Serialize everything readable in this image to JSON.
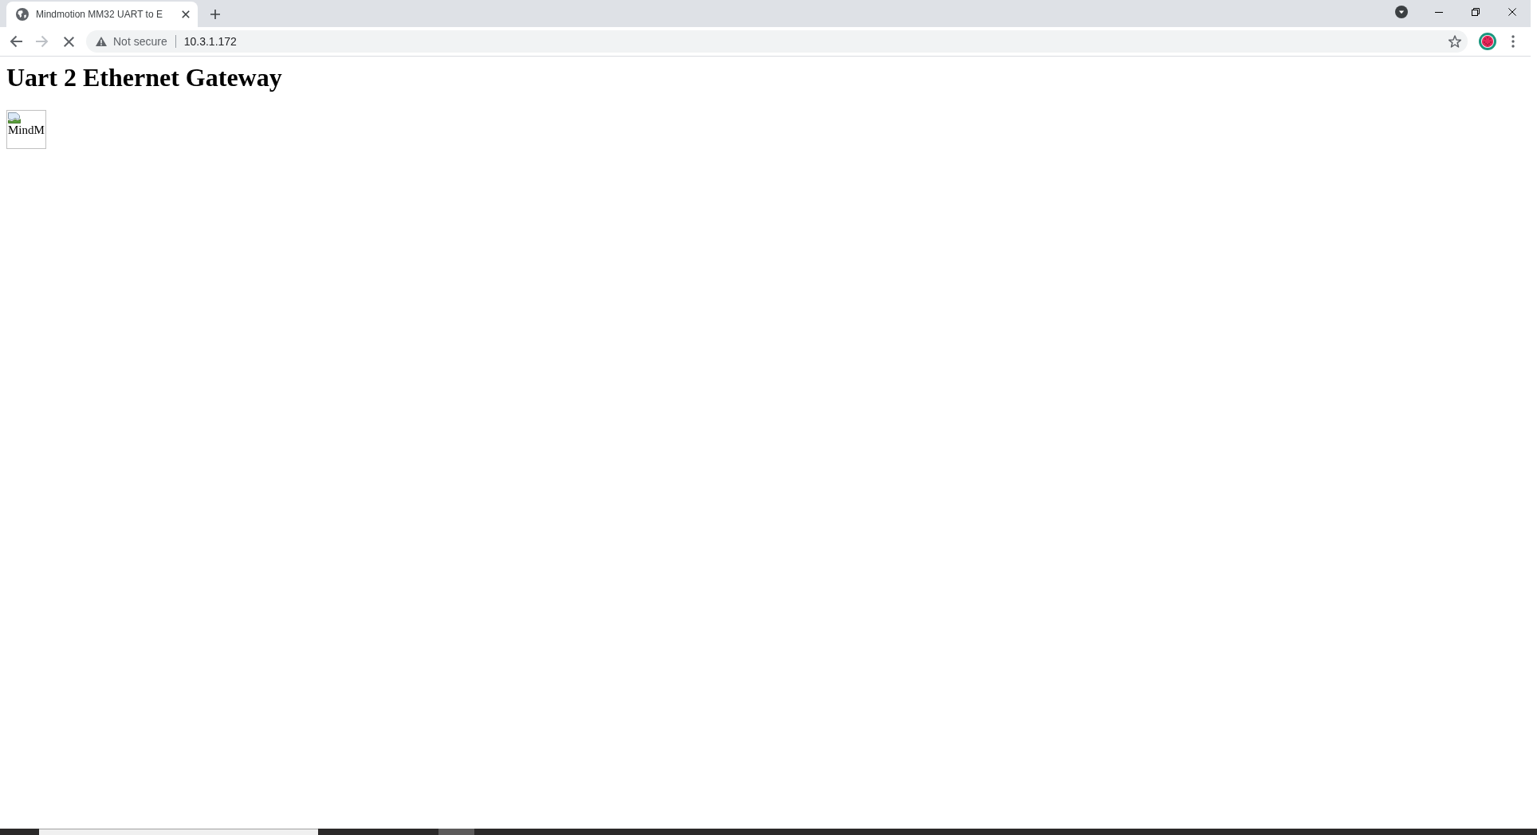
{
  "browser": {
    "tabs": [
      {
        "title": "Mindmotion MM32 UART to E",
        "selected": true
      }
    ],
    "toolbar": {
      "back": {
        "disabled": false
      },
      "forward": {
        "disabled": true
      },
      "loading": true,
      "security_label": "Not secure",
      "url": "10.3.1.172"
    }
  },
  "page": {
    "heading": "Uart 2 Ethernet Gateway",
    "image": {
      "alt": "MindM"
    }
  }
}
